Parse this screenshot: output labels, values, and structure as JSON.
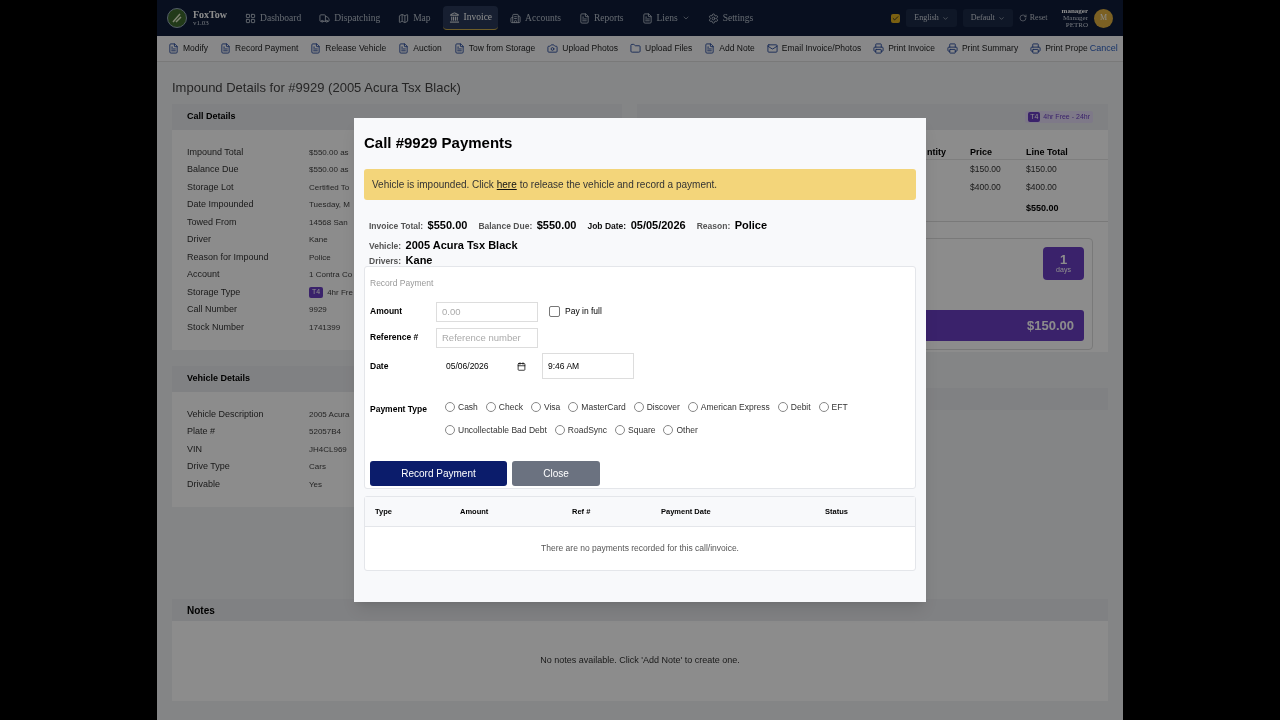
{
  "nav": {
    "brand": "FoxTow",
    "version": "v1.03",
    "items": [
      {
        "label": "Dashboard",
        "selected": false,
        "dropdown": false
      },
      {
        "label": "Dispatching",
        "selected": false,
        "dropdown": false
      },
      {
        "label": "Map",
        "selected": false,
        "dropdown": false
      },
      {
        "label": "Invoice",
        "selected": true,
        "dropdown": false
      },
      {
        "label": "Accounts",
        "selected": false,
        "dropdown": false
      },
      {
        "label": "Reports",
        "selected": false,
        "dropdown": false
      },
      {
        "label": "Liens",
        "selected": false,
        "dropdown": true
      },
      {
        "label": "Settings",
        "selected": false,
        "dropdown": false
      }
    ],
    "status_checked": true,
    "language": "English",
    "theme": "Default",
    "reset": "Reset",
    "user": {
      "name": "manager",
      "role": "Manager",
      "company": "PETRO",
      "initial": "M"
    }
  },
  "toolbar": {
    "actions": [
      "Modify",
      "Record Payment",
      "Release Vehicle",
      "Auction",
      "Tow from Storage",
      "Upload Photos",
      "Upload Files",
      "Add Note",
      "Email Invoice/Photos",
      "Print Invoice",
      "Print Summary",
      "Print Prope"
    ],
    "cancel": "Cancel"
  },
  "page_title": "Impound Details for #9929 (2005 Acura Tsx Black)",
  "call_details": {
    "title": "Call Details",
    "rows": [
      {
        "label": "Impound Total",
        "value": "$550.00 as"
      },
      {
        "label": "Balance Due",
        "value": "$550.00 as"
      },
      {
        "label": "Storage Lot",
        "value": "Certified To"
      },
      {
        "label": "Date Impounded",
        "value": "Tuesday, M"
      },
      {
        "label": "Towed From",
        "value": "14568 San"
      },
      {
        "label": "Driver",
        "value": "Kane"
      },
      {
        "label": "Reason for Impound",
        "value": "Police"
      },
      {
        "label": "Account",
        "value": "1 Contra Co"
      },
      {
        "label": "Storage Type",
        "badge": "T4",
        "value": "4hr Fre"
      },
      {
        "label": "Call Number",
        "value": "9929"
      },
      {
        "label": "Stock Number",
        "value": "1741399"
      }
    ]
  },
  "charges": {
    "badge": "T4",
    "storage": "4hr Free - 24hr",
    "columns": [
      "ntity",
      "Price",
      "Line Total"
    ],
    "rows": [
      {
        "price": "$150.00",
        "line_total": "$150.00"
      },
      {
        "price": "$400.00",
        "line_total": "$400.00"
      }
    ],
    "total": "$550.00",
    "days_count": "1",
    "days_unit": "days",
    "amount": "$150.00"
  },
  "vehicle_details": {
    "title": "Vehicle Details",
    "rows": [
      {
        "label": "Vehicle Description",
        "value": "2005 Acura"
      },
      {
        "label": "Plate #",
        "value": "52057B4"
      },
      {
        "label": "VIN",
        "value": "JH4CL969"
      },
      {
        "label": "Drive Type",
        "value": "Cars"
      },
      {
        "label": "Drivable",
        "value": "Yes"
      }
    ]
  },
  "notes": {
    "title": "Notes",
    "empty": "No notes available. Click 'Add Note' to create one."
  },
  "modal": {
    "title": "Call #9929 Payments",
    "alert": {
      "before": "Vehicle is impounded. Click",
      "link": "here",
      "after": "to release the vehicle and record a payment."
    },
    "summary": [
      {
        "label": "Invoice Total:",
        "value": "$550.00",
        "strong": false
      },
      {
        "label": "Balance Due:",
        "value": "$550.00",
        "strong": false
      },
      {
        "label": "Job Date:",
        "value": "05/05/2026",
        "strong": true
      },
      {
        "label": "Reason:",
        "value": "Police",
        "strong": false
      }
    ],
    "vehicle": {
      "label": "Vehicle:",
      "value": "2005 Acura Tsx Black"
    },
    "drivers": {
      "label": "Drivers:",
      "value": "Kane"
    },
    "form": {
      "legend": "Record Payment",
      "amount": {
        "label": "Amount",
        "placeholder": "0.00"
      },
      "pay_in_full": {
        "label": "Pay in full",
        "checked": false
      },
      "reference": {
        "label": "Reference #",
        "placeholder": "Reference number"
      },
      "date": {
        "label": "Date",
        "value": "05/06/2026",
        "time": "9:46 AM"
      },
      "payment_type": {
        "label": "Payment Type",
        "options": [
          {
            "label": "Cash",
            "selected": false
          },
          {
            "label": "Check",
            "selected": false
          },
          {
            "label": "Visa",
            "selected": false
          },
          {
            "label": "MasterCard",
            "selected": false
          },
          {
            "label": "Discover",
            "selected": false
          },
          {
            "label": "American Express",
            "selected": false
          },
          {
            "label": "Debit",
            "selected": false
          },
          {
            "label": "EFT",
            "selected": false
          },
          {
            "label": "Uncollectable Bad Debt",
            "selected": false
          },
          {
            "label": "RoadSync",
            "selected": false
          },
          {
            "label": "Square",
            "selected": false
          },
          {
            "label": "Other",
            "selected": false
          }
        ]
      },
      "submit": "Record Payment",
      "close": "Close"
    },
    "table": {
      "columns": [
        "Type",
        "Amount",
        "Ref #",
        "Payment Date",
        "Status"
      ],
      "empty": "There are no payments recorded for this call/invoice."
    }
  }
}
